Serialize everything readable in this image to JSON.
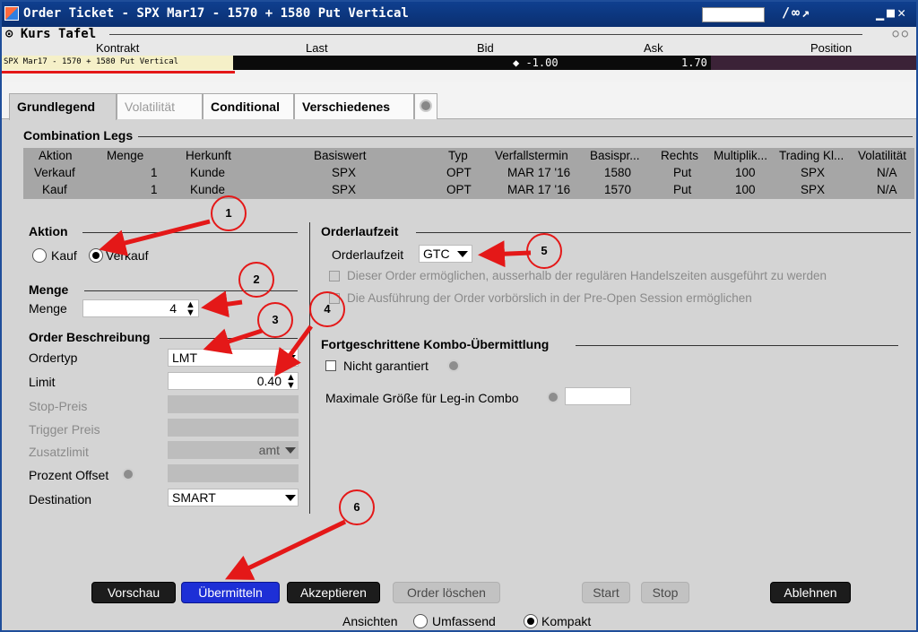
{
  "window": {
    "title": "Order Ticket - SPX Mar17  - 1570  + 1580 Put Vertical",
    "icons": [
      "link-icon",
      "chain-icon",
      "pin-icon",
      "minimize-icon",
      "maximize-icon",
      "close-icon"
    ]
  },
  "kurs_tafel": {
    "title": "Kurs Tafel",
    "columns": [
      "Kontrakt",
      "Last",
      "Bid",
      "Ask",
      "Position"
    ],
    "row": {
      "contract": "SPX Mar17 - 1570 + 1580 Put Vertical",
      "bid": "◆ -1.00",
      "ask": "1.70 ◆"
    }
  },
  "tabs": [
    "Grundlegend",
    "Volatilität",
    "Conditional",
    "Verschiedenes"
  ],
  "combination_legs": {
    "title": "Combination Legs",
    "headers": [
      "Aktion",
      "Menge",
      "Herkunft",
      "Basiswert",
      "Typ",
      "Verfallstermin",
      "Basispr...",
      "Rechts",
      "Multiplik...",
      "Trading Kl...",
      "Volatilität"
    ],
    "rows": [
      [
        "Verkauf",
        "1",
        "Kunde",
        "SPX",
        "OPT",
        "MAR 17 '16",
        "1580",
        "Put",
        "100",
        "SPX",
        "N/A"
      ],
      [
        "Kauf",
        "1",
        "Kunde",
        "SPX",
        "OPT",
        "MAR 17 '16",
        "1570",
        "Put",
        "100",
        "SPX",
        "N/A"
      ]
    ]
  },
  "aktion": {
    "title": "Aktion",
    "option_buy": "Kauf",
    "option_sell": "Verkauf",
    "selected": "Verkauf"
  },
  "menge": {
    "title": "Menge",
    "label": "Menge",
    "value": "4"
  },
  "order_beschreibung": {
    "title": "Order Beschreibung",
    "ordertyp_label": "Ordertyp",
    "ordertyp_value": "LMT",
    "limit_label": "Limit",
    "limit_value": "0.40",
    "stop_label": "Stop-Preis",
    "trigger_label": "Trigger Preis",
    "zusatzlimit_label": "Zusatzlimit",
    "zusatzlimit_value": "amt",
    "prozent_label": "Prozent Offset",
    "destination_label": "Destination",
    "destination_value": "SMART"
  },
  "orderlaufzeit": {
    "title": "Orderlaufzeit",
    "label": "Orderlaufzeit",
    "value": "GTC",
    "check1": "Dieser Order ermöglichen, ausserhalb der regulären Handelszeiten ausgeführt zu werden",
    "check2": "Die Ausführung der Order vorbörslich in der Pre-Open Session ermöglichen"
  },
  "kombo": {
    "title": "Fortgeschrittene Kombo-Übermittlung",
    "nicht_garantiert": "Nicht garantiert",
    "max_label": "Maximale Größe für Leg-in Combo"
  },
  "buttons": {
    "vorschau": "Vorschau",
    "uebermitteln": "Übermitteln",
    "akzeptieren": "Akzeptieren",
    "order_loeschen": "Order löschen",
    "start": "Start",
    "stop": "Stop",
    "ablehnen": "Ablehnen"
  },
  "ansichten": {
    "label": "Ansichten",
    "umfassend": "Umfassend",
    "kompakt": "Kompakt",
    "selected": "Kompakt"
  },
  "annotations": [
    "1",
    "2",
    "3",
    "4",
    "5",
    "6"
  ],
  "colors": {
    "annotation": "#e41818",
    "title_bar": "#0f3f8f",
    "primary_button": "#1d2fd6"
  }
}
